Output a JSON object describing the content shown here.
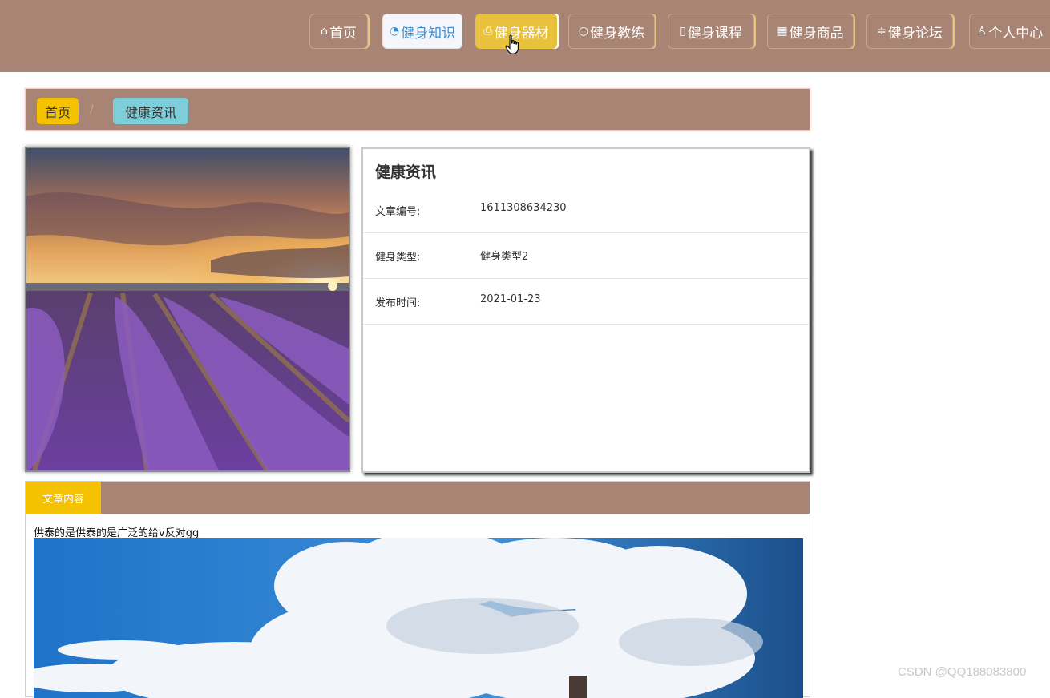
{
  "nav": {
    "items": [
      {
        "label": "首页",
        "icon": "home-icon"
      },
      {
        "label": "健身知识",
        "icon": "gauge-icon"
      },
      {
        "label": "健身器材",
        "icon": "printer-icon"
      },
      {
        "label": "健身教练",
        "icon": "circle-icon"
      },
      {
        "label": "健身课程",
        "icon": "document-icon"
      },
      {
        "label": "健身商品",
        "icon": "grid-icon"
      },
      {
        "label": "健身论坛",
        "icon": "sliders-icon"
      },
      {
        "label": "个人中心",
        "icon": "user-icon"
      }
    ],
    "active_hover": "健身器材",
    "active_selected": "健身知识"
  },
  "breadcrumb": {
    "home": "首页",
    "separator": "/",
    "current": "健康资讯"
  },
  "detail": {
    "title": "健康资讯",
    "rows": [
      {
        "label": "文章编号:",
        "value": "1611308634230"
      },
      {
        "label": "健身类型:",
        "value": "健身类型2"
      },
      {
        "label": "发布时间:",
        "value": "2021-01-23"
      }
    ]
  },
  "content": {
    "tab_label": "文章内容",
    "text": "供泰的是供泰的是广泛的给v反对gg"
  },
  "watermark": "CSDN @QQ188083800",
  "colors": {
    "brand_brown": "#a88474",
    "accent_yellow": "#f5c200",
    "accent_cyan": "#7ccfd8"
  }
}
